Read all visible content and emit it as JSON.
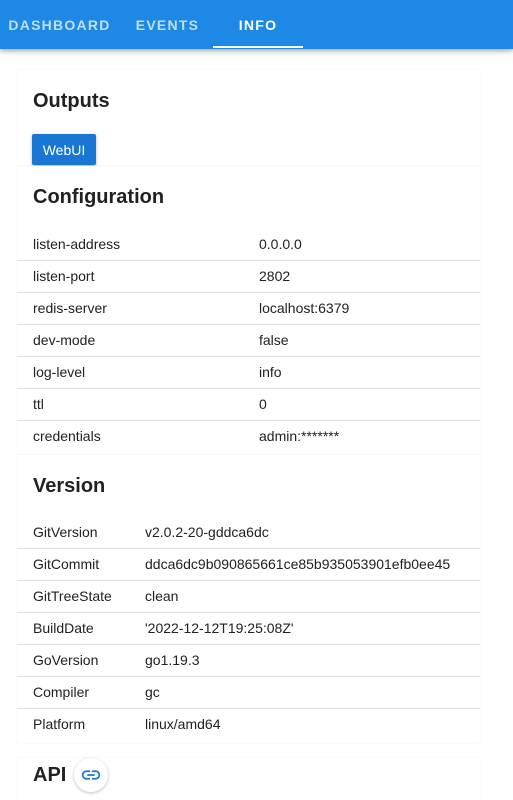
{
  "tabs": [
    {
      "label": "DASHBOARD"
    },
    {
      "label": "EVENTS"
    },
    {
      "label": "INFO"
    }
  ],
  "outputs": {
    "title": "Outputs",
    "webui_label": "WebUI"
  },
  "configuration": {
    "title": "Configuration",
    "rows": [
      {
        "key": "listen-address",
        "value": "0.0.0.0"
      },
      {
        "key": "listen-port",
        "value": "2802"
      },
      {
        "key": "redis-server",
        "value": "localhost:6379"
      },
      {
        "key": "dev-mode",
        "value": "false"
      },
      {
        "key": "log-level",
        "value": "info"
      },
      {
        "key": "ttl",
        "value": "0"
      },
      {
        "key": "credentials",
        "value": "admin:*******"
      }
    ]
  },
  "version": {
    "title": "Version",
    "rows": [
      {
        "key": "GitVersion",
        "value": "v2.0.2-20-gddca6dc"
      },
      {
        "key": "GitCommit",
        "value": "ddca6dc9b090865661ce85b935053901efb0ee45"
      },
      {
        "key": "GitTreeState",
        "value": "clean"
      },
      {
        "key": "BuildDate",
        "value": "'2022-12-12T19:25:08Z'"
      },
      {
        "key": "GoVersion",
        "value": "go1.19.3"
      },
      {
        "key": "Compiler",
        "value": "gc"
      },
      {
        "key": "Platform",
        "value": "linux/amd64"
      }
    ]
  },
  "api": {
    "title": "API",
    "link_icon": "link-icon"
  },
  "colors": {
    "appbar": "#1e88e5",
    "button": "#1976d2",
    "divider": "#e0e0e0"
  }
}
